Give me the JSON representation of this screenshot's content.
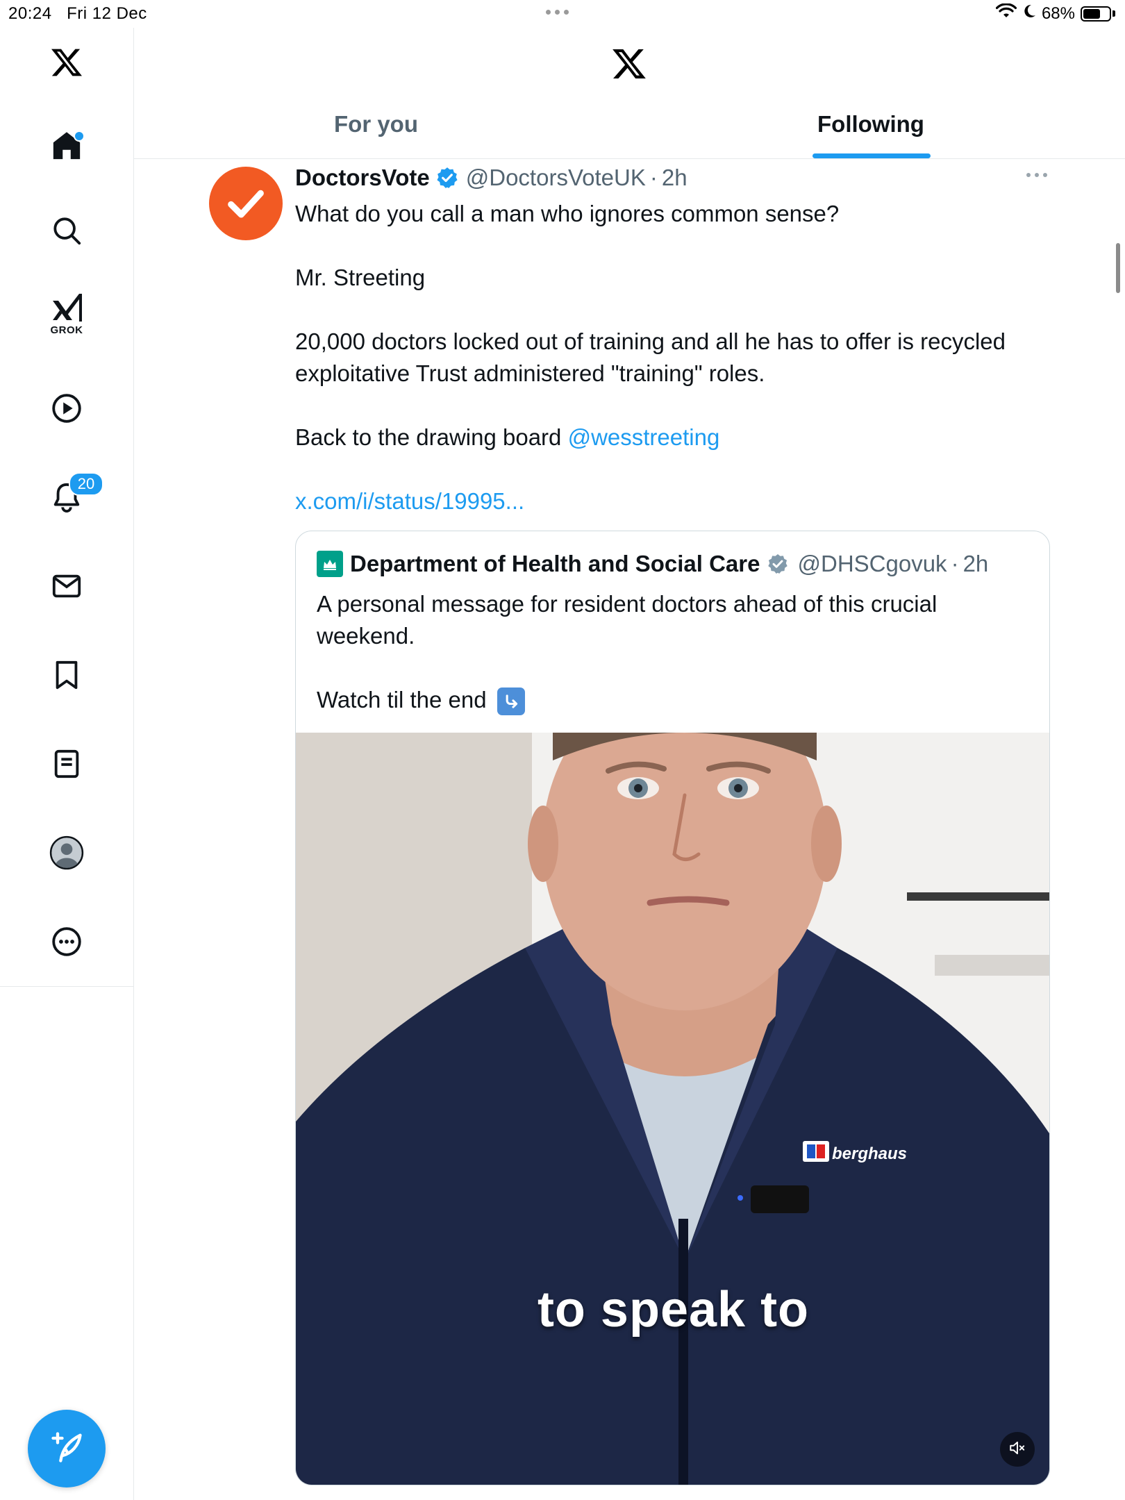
{
  "status_bar": {
    "time": "20:24",
    "date": "Fri 12 Dec",
    "battery_percent": "68%",
    "battery_level": 0.68
  },
  "sidebar": {
    "items": [
      {
        "name": "x-logo"
      },
      {
        "name": "home",
        "has_dot": true
      },
      {
        "name": "search"
      },
      {
        "name": "grok",
        "label": "GROK"
      },
      {
        "name": "videos"
      },
      {
        "name": "notifications",
        "badge": "20"
      },
      {
        "name": "messages"
      },
      {
        "name": "bookmarks"
      },
      {
        "name": "lists"
      },
      {
        "name": "profile"
      },
      {
        "name": "more"
      }
    ]
  },
  "header": {
    "tabs": [
      {
        "label": "For you",
        "active": false
      },
      {
        "label": "Following",
        "active": true
      }
    ]
  },
  "tweet": {
    "author_name": "DoctorsVote",
    "handle": "@DoctorsVoteUK",
    "separator": "·",
    "time": "2h",
    "avatar_color": "#f25a23",
    "text_line1": "What do you call a man who ignores common sense?",
    "text_line2": "Mr. Streeting",
    "text_line3": "20,000 doctors locked out of training and all he has to offer is recycled exploitative Trust administered \"training\" roles.",
    "text_line4": "Back to the drawing board ",
    "mention": "@wesstreeting",
    "link": "x.com/i/status/19995..."
  },
  "quote": {
    "author_name": "Department of Health and Social Care",
    "handle": "@DHSCgovuk",
    "separator": "·",
    "time": "2h",
    "logo_color": "#00a08a",
    "text_line1": "A personal message for resident doctors ahead of this crucial weekend.",
    "text_line2": "Watch til the end",
    "video_caption": "to speak to",
    "jacket_brand": "berghaus"
  },
  "colors": {
    "accent": "#1d9bf0",
    "text": "#0f1419",
    "secondary": "#536471"
  }
}
